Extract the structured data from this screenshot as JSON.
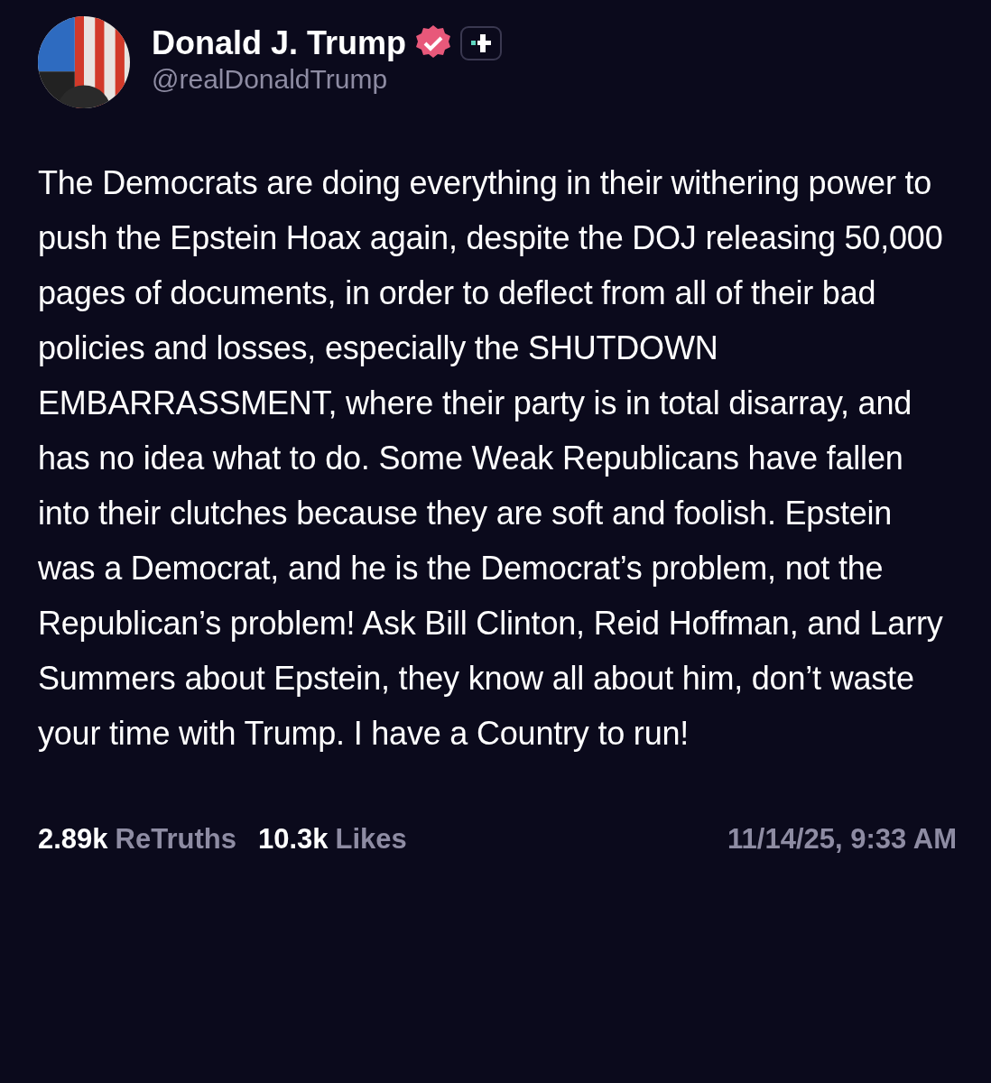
{
  "author": {
    "name": "Donald J. Trump",
    "verified": true,
    "handle": "@realDonaldTrump"
  },
  "post": {
    "text": "The Democrats are doing everything in their withering power to push the Epstein Hoax again, despite the DOJ releasing 50,000 pages of documents, in order to deflect from all of their bad policies and losses, especially the SHUTDOWN EMBARRASSMENT, where their party is in total disarray, and has no idea what to do. Some Weak Republicans have fallen into their clutches because they are soft and foolish. Epstein was a Democrat, and he is the Democrat’s problem, not the Republican’s problem! Ask Bill Clinton, Reid Hoffman, and Larry Summers about Epstein, they know all about him, don’t waste your time with Trump. I have a Country to run!"
  },
  "stats": [
    {
      "count": "2.89k",
      "label": "ReTruths"
    },
    {
      "count": "10.3k",
      "label": "Likes"
    }
  ],
  "timestamp": "11/14/25, 9:33 AM"
}
